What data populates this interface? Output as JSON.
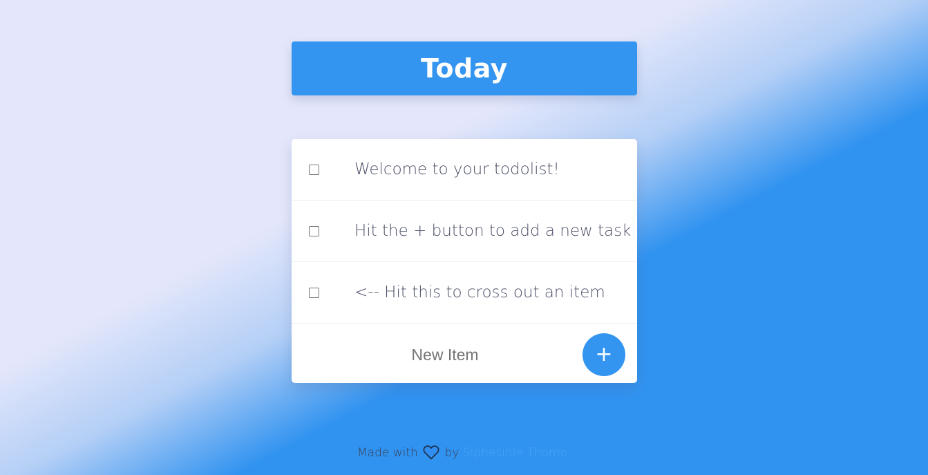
{
  "header": {
    "title": "Today"
  },
  "todos": [
    {
      "label": "Welcome to your todolist!",
      "checked": false
    },
    {
      "label": "Hit the + button to add a new task",
      "checked": false
    },
    {
      "label": "<-- Hit this to cross out an item",
      "checked": false
    }
  ],
  "new_item": {
    "placeholder": "New Item",
    "add_label": "+"
  },
  "footer": {
    "made_with": "Made with",
    "by": "by",
    "author": "Siphesihle Thomo",
    "period": ".",
    "heart_icon": "heart-icon"
  },
  "colors": {
    "accent": "#3395f0",
    "background": "#e4e7fb",
    "link": "#4aa3f3"
  }
}
